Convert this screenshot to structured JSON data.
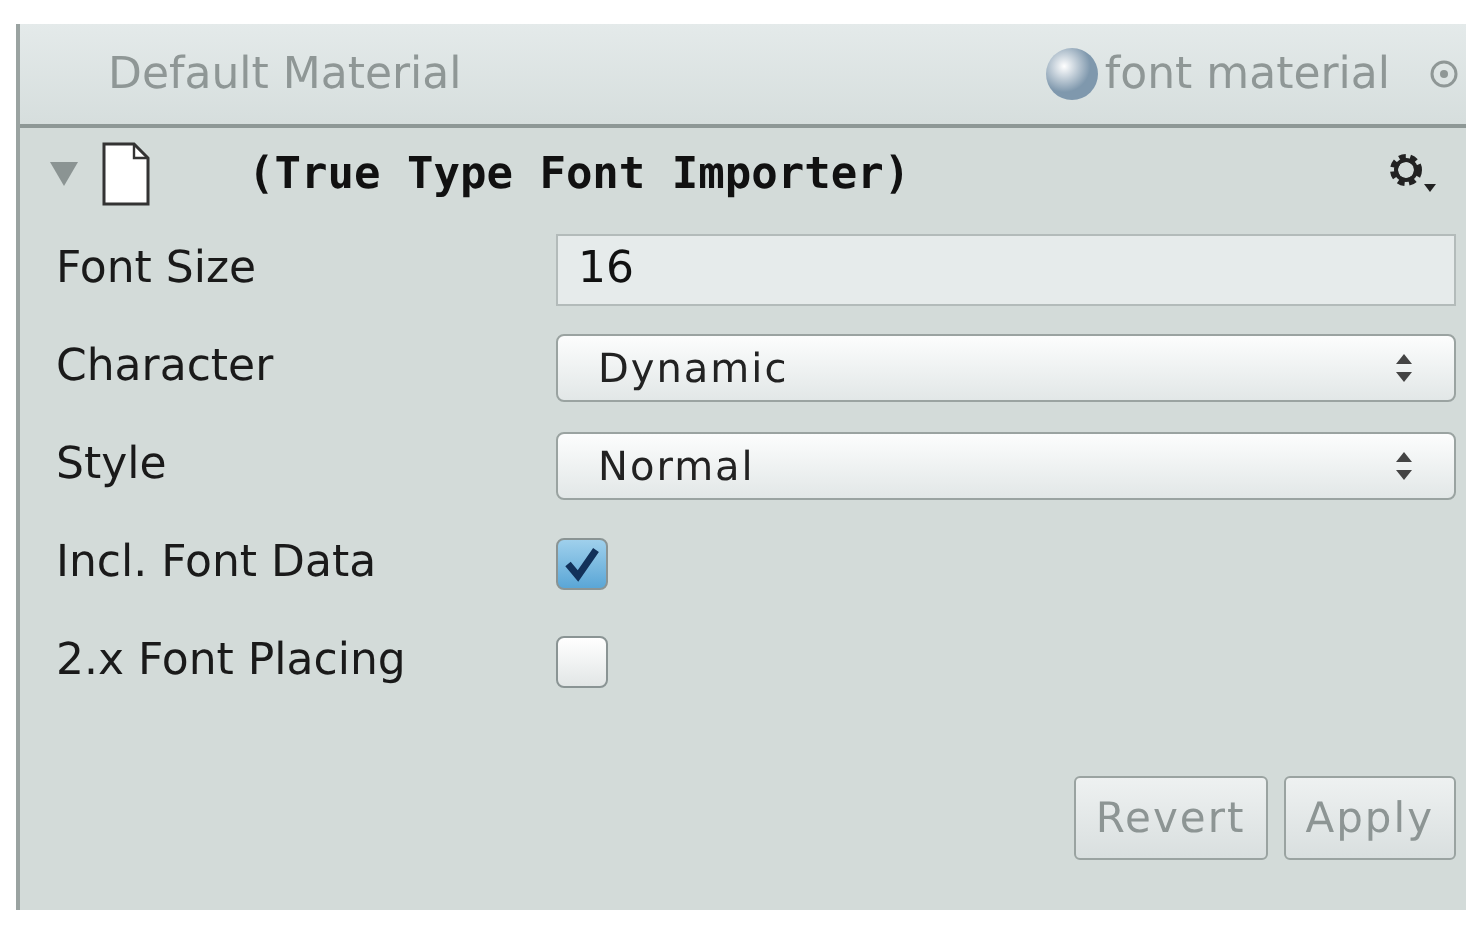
{
  "material_bar": {
    "default_label": "Default Material",
    "material_name": "font material"
  },
  "component": {
    "title": "(True Type Font Importer)",
    "expanded": true
  },
  "fields": [
    {
      "kind": "text",
      "label": "Font Size",
      "value": "16"
    },
    {
      "kind": "dropdown",
      "label": "Character",
      "value": "Dynamic"
    },
    {
      "kind": "dropdown",
      "label": "Style",
      "value": "Normal"
    },
    {
      "kind": "checkbox",
      "label": "Incl. Font Data",
      "checked": true
    },
    {
      "kind": "checkbox",
      "label": "2.x Font Placing",
      "checked": false
    }
  ],
  "buttons": [
    {
      "label": "Revert",
      "disabled": true
    },
    {
      "label": "Apply",
      "disabled": true
    }
  ]
}
